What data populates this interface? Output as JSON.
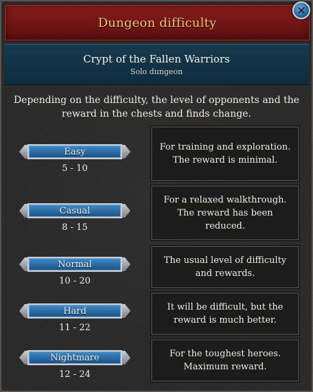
{
  "window": {
    "title": "Dungeon difficulty",
    "close_label": "✕"
  },
  "dungeon": {
    "name": "Crypt of the Fallen Warriors",
    "type": "Solo dungeon"
  },
  "description": "Depending on the difficulty, the level of opponents and the reward in the chests and finds change.",
  "levels": [
    {
      "label": "Easy",
      "range": "5 - 10",
      "info": "For training and exploration. The reward is minimal."
    },
    {
      "label": "Casual",
      "range": "8 - 15",
      "info": "For a relaxed walkthrough. The reward has been reduced."
    },
    {
      "label": "Normal",
      "range": "10 - 20",
      "info": "The usual level of difficulty and rewards."
    },
    {
      "label": "Hard",
      "range": "11 - 22",
      "info": "It will be difficult, but the reward is much better."
    },
    {
      "label": "Nightmare",
      "range": "12 - 24",
      "info": "For the toughest heroes. Maximum reward."
    }
  ],
  "colors": {
    "title_bar": "#7a1a1a",
    "title_text": "#f2c472",
    "header_bg": "#173a4f",
    "button_blue": "#2a6aa3"
  }
}
